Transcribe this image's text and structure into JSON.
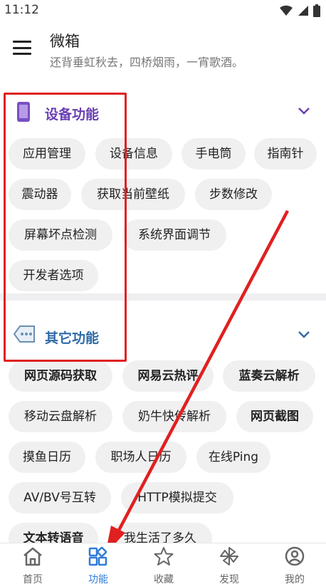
{
  "status_bar": {
    "time": "11:12"
  },
  "header": {
    "title": "微箱",
    "subtitle": "还背垂虹秋去，四桥烟雨，一宵歌酒。"
  },
  "sections": [
    {
      "title": "设备功能",
      "title_color": "#6a3fb3",
      "icon": "phone-icon",
      "items": [
        "应用管理",
        "设备信息",
        "手电筒",
        "指南针",
        "震动器",
        "获取当前壁纸",
        "步数修改",
        "屏幕坏点检测",
        "系统界面调节",
        "开发者选项"
      ]
    },
    {
      "title": "其它功能",
      "title_color": "#2f6aa8",
      "icon": "chat-tag-icon",
      "items": [
        "网页源码获取",
        "网易云热评",
        "蓝奏云解析",
        "移动云盘解析",
        "奶牛快传解析",
        "网页截图",
        "摸鱼日历",
        "职场人日历",
        "在线Ping",
        "AV/BV号互转",
        "HTTP模拟提交",
        "文本转语音",
        "我生活了多久"
      ]
    }
  ],
  "bottom_nav": [
    {
      "label": "首页",
      "icon": "home-icon"
    },
    {
      "label": "功能",
      "icon": "grid-icon",
      "active": true
    },
    {
      "label": "收藏",
      "icon": "star-icon"
    },
    {
      "label": "发现",
      "icon": "pinwheel-icon"
    },
    {
      "label": "我的",
      "icon": "profile-icon"
    }
  ],
  "colors": {
    "accent": "#2f7bd8",
    "highlight": "#e02020"
  }
}
